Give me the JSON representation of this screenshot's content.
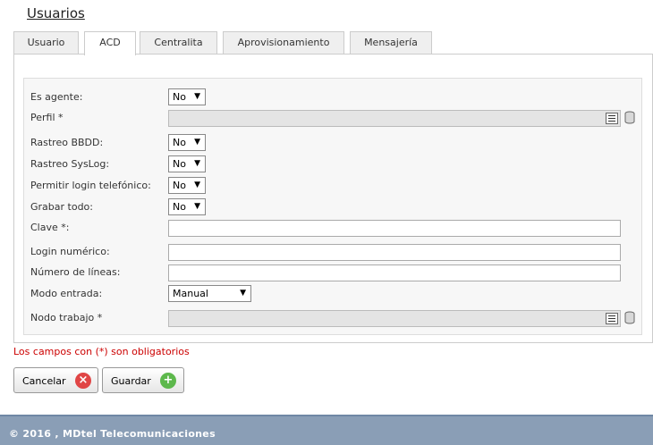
{
  "page": {
    "title": "Usuarios"
  },
  "tabs": [
    {
      "label": "Usuario",
      "active": false
    },
    {
      "label": "ACD",
      "active": true
    },
    {
      "label": "Centralita",
      "active": false
    },
    {
      "label": "Aprovisionamiento",
      "active": false
    },
    {
      "label": "Mensajería",
      "active": false
    }
  ],
  "form": {
    "es_agente": {
      "label": "Es agente:",
      "value": "No"
    },
    "perfil": {
      "label": "Perfil *",
      "value": ""
    },
    "rastreo_bbdd": {
      "label": "Rastreo BBDD:",
      "value": "No"
    },
    "rastreo_syslog": {
      "label": "Rastreo SysLog:",
      "value": "No"
    },
    "permitir_login": {
      "label": "Permitir login telefónico:",
      "value": "No"
    },
    "grabar_todo": {
      "label": "Grabar todo:",
      "value": "No"
    },
    "clave": {
      "label": "Clave *:",
      "value": ""
    },
    "login_numerico": {
      "label": "Login numérico:",
      "value": ""
    },
    "numero_lineas": {
      "label": "Número de líneas:",
      "value": ""
    },
    "modo_entrada": {
      "label": "Modo entrada:",
      "value": "Manual"
    },
    "nodo_trabajo": {
      "label": "Nodo trabajo *",
      "value": ""
    }
  },
  "required_note": "Los campos con (*) son obligatorios",
  "buttons": {
    "cancel": "Cancelar",
    "save": "Guardar"
  },
  "icons": {
    "dropdown": "triangle-down-icon",
    "list": "list-icon",
    "database": "database-icon",
    "cancel": "x-circle-icon",
    "save": "plus-circle-icon"
  },
  "colors": {
    "required_text": "#cc0000",
    "footer_bg": "#8a9eb6",
    "cancel_icon": "#e04545",
    "save_icon": "#5db84c"
  },
  "footer": {
    "text": "© 2016 , MDtel Telecomunicaciones"
  }
}
